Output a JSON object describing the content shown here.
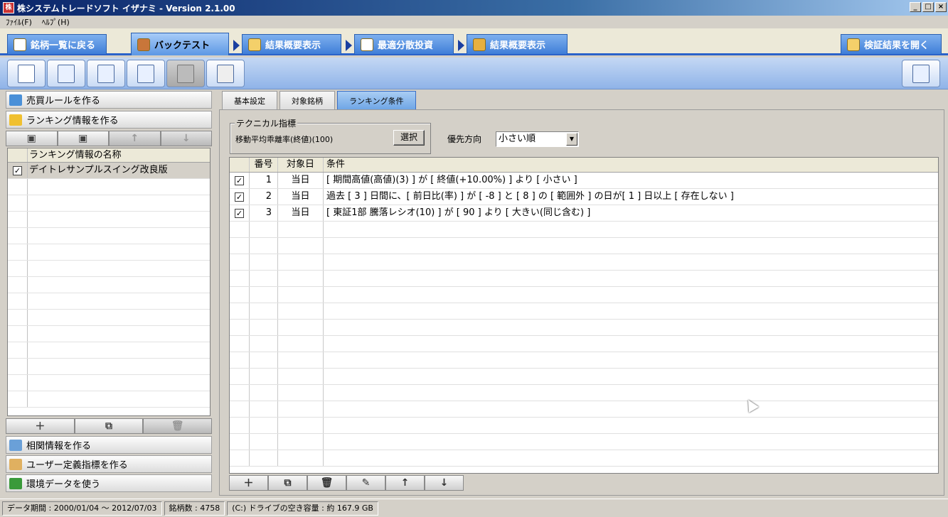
{
  "window": {
    "title": "株システムトレードソフト イザナミ - Version 2.1.00"
  },
  "menu": [
    "ﾌｧｲﾙ(F)",
    "ﾍﾙﾌﾟ(H)"
  ],
  "steps": {
    "back_to_list": "銘柄一覧に戻る",
    "backtest": "バックテスト",
    "summary1": "結果概要表示",
    "optimal": "最適分散投資",
    "summary2": "結果概要表示",
    "open_results": "検証結果を開く"
  },
  "left": {
    "trade_rules": "売買ルールを作る",
    "ranking_info": "ランキング情報を作る",
    "table_header": "ランキング情報の名称",
    "items": [
      {
        "name": "デイトレサンプルスイング改良版",
        "checked": "✓"
      }
    ],
    "correlation": "相関情報を作る",
    "user_indicator": "ユーザー定義指標を作る",
    "env_data": "環境データを使う"
  },
  "tabs": [
    "基本設定",
    "対象銘柄",
    "ランキング条件"
  ],
  "ranking": {
    "indicator_legend": "テクニカル指標",
    "indicator_value": "移動平均乖離率(終値)(100)",
    "select_button": "選択",
    "priority_label": "優先方向",
    "priority_value": "小さい順"
  },
  "grid": {
    "headers": {
      "num": "番号",
      "day": "対象日",
      "cond": "条件"
    },
    "rows": [
      {
        "checked": "✓",
        "num": "1",
        "day": "当日",
        "cond": "[ 期間高値(高値)(3) ] が [ 終値(+10.00%) ] より [ 小さい ]"
      },
      {
        "checked": "✓",
        "num": "2",
        "day": "当日",
        "cond": "過去 [ 3 ] 日間に、[ 前日比(率) ] が [ -8 ] と [ 8 ] の [ 範囲外 ] の日が[ 1 ] 日以上 [ 存在しない ]"
      },
      {
        "checked": "✓",
        "num": "3",
        "day": "当日",
        "cond": "[ 東証1部 騰落レシオ(10) ] が [ 90 ] より [ 大きい(同じ含む) ]"
      }
    ]
  },
  "status": {
    "period": "データ期間 : 2000/01/04 〜 2012/07/03",
    "count": "銘柄数 : 4758",
    "disk": "(C:) ドライブの空き容量 : 約 167.9 GB"
  }
}
